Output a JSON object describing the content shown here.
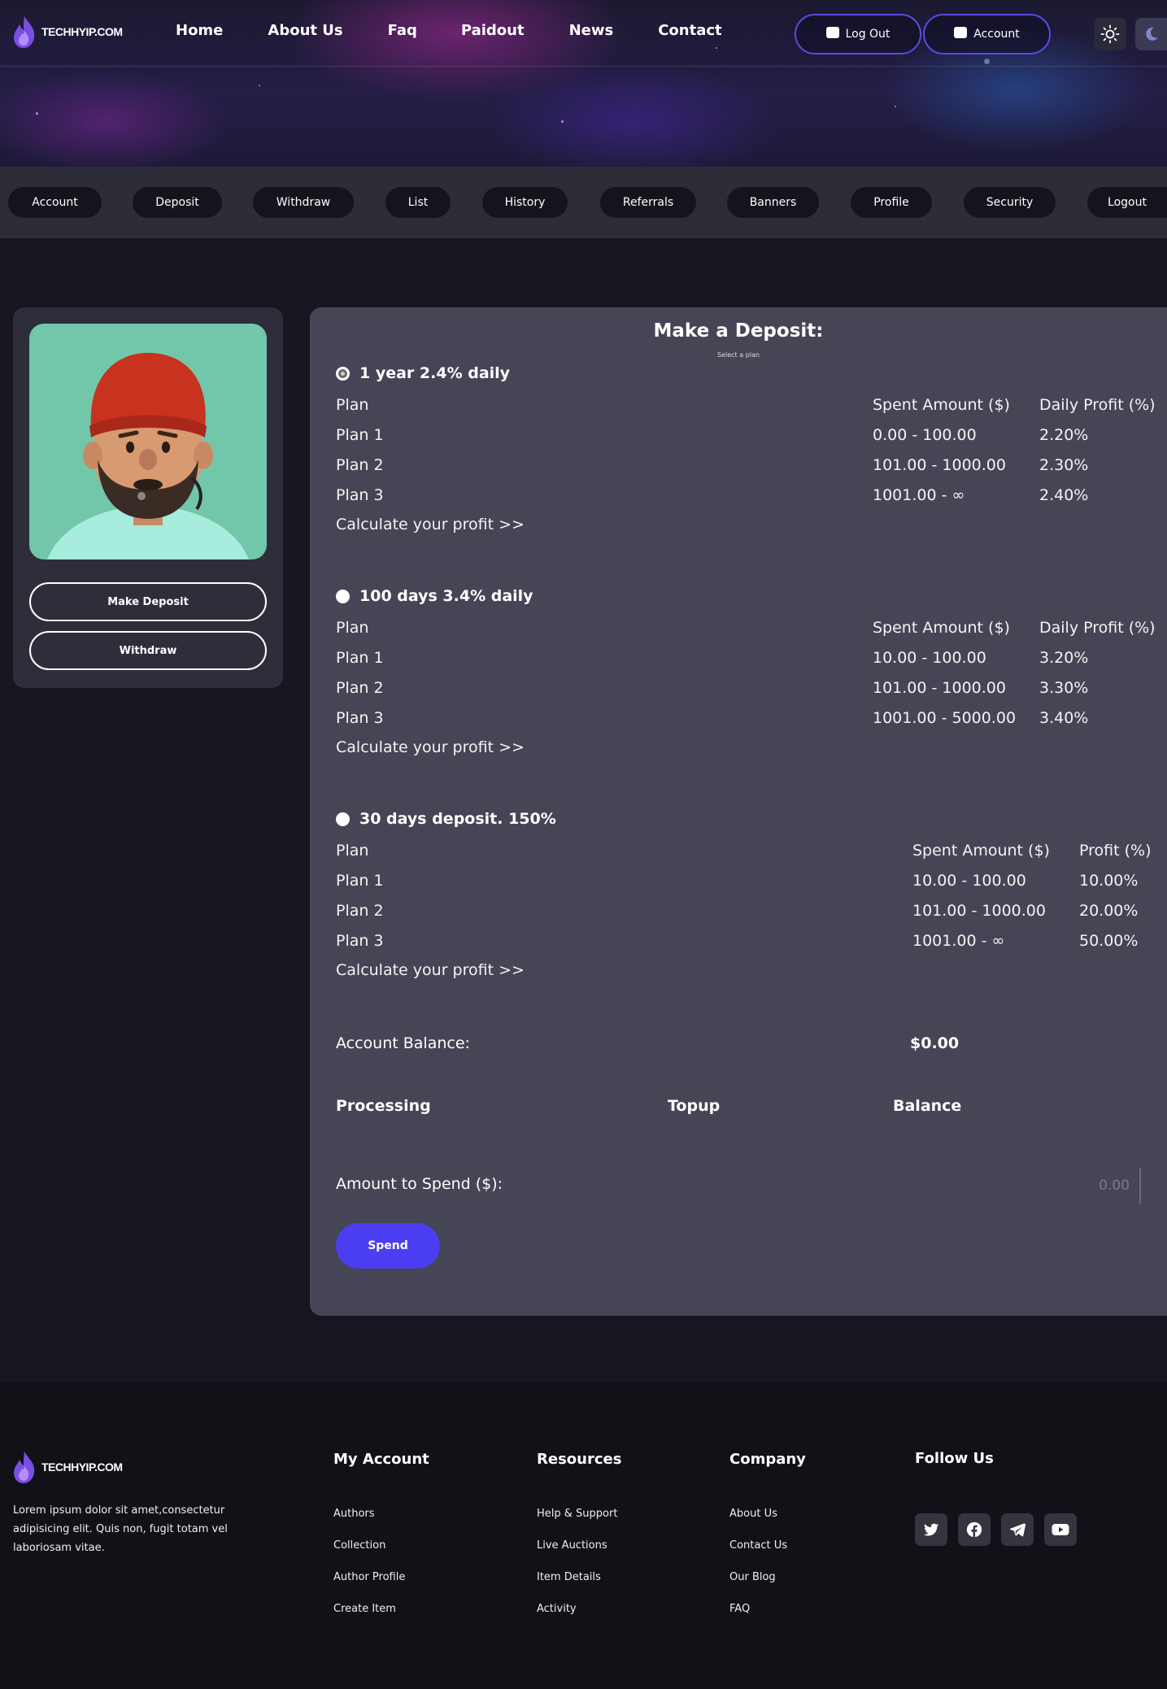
{
  "brand": {
    "name": "TECHHYIP.COM"
  },
  "nav": {
    "items": [
      "Home",
      "About Us",
      "Faq",
      "Paidout",
      "News",
      "Contact"
    ]
  },
  "header": {
    "logout_label": "Log Out",
    "account_label": "Account"
  },
  "tabs": [
    "Account",
    "Deposit",
    "Withdraw",
    "List",
    "History",
    "Referrals",
    "Banners",
    "Profile",
    "Security",
    "Logout"
  ],
  "sidebar": {
    "make_deposit_label": "Make Deposit",
    "withdraw_label": "Withdraw"
  },
  "deposit": {
    "title": "Make a Deposit:",
    "subtitle": "Select a plan",
    "plans": [
      {
        "name": "1 year 2.4% daily",
        "selected": true,
        "headers": [
          "Plan",
          "Spent Amount ($)",
          "Daily Profit (%)"
        ],
        "rows": [
          [
            "Plan 1",
            "0.00 - 100.00",
            "2.20%"
          ],
          [
            "Plan 2",
            "101.00 - 1000.00",
            "2.30%"
          ],
          [
            "Plan 3",
            "1001.00 - ∞",
            "2.40%"
          ]
        ],
        "calc_label": "Calculate your profit >>"
      },
      {
        "name": "100 days 3.4% daily",
        "selected": false,
        "headers": [
          "Plan",
          "Spent Amount ($)",
          "Daily Profit (%)"
        ],
        "rows": [
          [
            "Plan 1",
            "10.00 - 100.00",
            "3.20%"
          ],
          [
            "Plan 2",
            "101.00 - 1000.00",
            "3.30%"
          ],
          [
            "Plan 3",
            "1001.00 - 5000.00",
            "3.40%"
          ]
        ],
        "calc_label": "Calculate your profit >>"
      },
      {
        "name": "30 days deposit. 150%",
        "selected": false,
        "headers": [
          "Plan",
          "Spent Amount ($)",
          "Profit (%)"
        ],
        "rows": [
          [
            "Plan 1",
            "10.00 - 100.00",
            "10.00%"
          ],
          [
            "Plan 2",
            "101.00 - 1000.00",
            "20.00%"
          ],
          [
            "Plan 3",
            "1001.00 - ∞",
            "50.00%"
          ]
        ],
        "calc_label": "Calculate your profit >>"
      }
    ],
    "balance_label": "Account Balance:",
    "balance_value": "$0.00",
    "processing_headers": [
      "Processing",
      "Topup",
      "Balance"
    ],
    "amount_label": "Amount to Spend ($):",
    "amount_placeholder": "0.00",
    "spend_label": "Spend"
  },
  "footer": {
    "description": "Lorem ipsum dolor sit amet,consectetur adipisicing elit. Quis non, fugit totam vel laboriosam vitae.",
    "columns": [
      {
        "title": "My Account",
        "links": [
          "Authors",
          "Collection",
          "Author Profile",
          "Create Item"
        ]
      },
      {
        "title": "Resources",
        "links": [
          "Help & Support",
          "Live Auctions",
          "Item Details",
          "Activity"
        ]
      },
      {
        "title": "Company",
        "links": [
          "About Us",
          "Contact Us",
          "Our Blog",
          "FAQ"
        ]
      }
    ],
    "follow_title": "Follow Us",
    "social_icons": [
      "twitter-icon",
      "facebook-icon",
      "telegram-icon",
      "youtube-icon"
    ]
  },
  "colors": {
    "accent": "#4b3df2",
    "outline": "#5a4be0",
    "panel": "#454556",
    "sidebar": "#2e2e3b",
    "avatar_bg": "#72c6a9"
  }
}
